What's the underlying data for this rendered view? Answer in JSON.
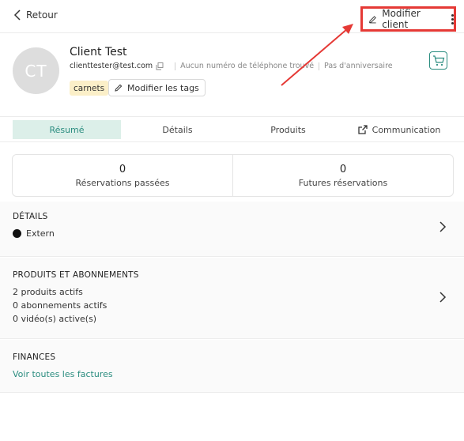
{
  "header": {
    "back_label": "Retour",
    "edit_client_label": "Modifier client"
  },
  "client": {
    "initials": "CT",
    "name": "Client Test",
    "email": "clienttester@test.com",
    "phone": "Aucun numéro de téléphone trouvé",
    "birthday": "Pas d'anniversaire",
    "tag": "carnets",
    "edit_tags_label": "Modifier les tags"
  },
  "tabs": [
    {
      "label": "Résumé",
      "active": true
    },
    {
      "label": "Détails",
      "active": false
    },
    {
      "label": "Produits",
      "active": false
    },
    {
      "label": "Communication",
      "active": false,
      "icon": "external-link-icon"
    }
  ],
  "stats": [
    {
      "value": "0",
      "label": "Réservations passées"
    },
    {
      "value": "0",
      "label": "Futures réservations"
    }
  ],
  "details": {
    "title": "DÉTAILS",
    "status": "Extern"
  },
  "products": {
    "title": "PRODUITS ET ABONNEMENTS",
    "lines": [
      "2 produits actifs",
      "0 abonnements actifs",
      "0 vidéo(s) active(s)"
    ]
  },
  "finances": {
    "title": "FINANCES",
    "link": "Voir toutes les factures"
  },
  "colors": {
    "accent": "#2a8c7f",
    "highlight": "#e53935",
    "tag_bg": "#fbefc8"
  }
}
